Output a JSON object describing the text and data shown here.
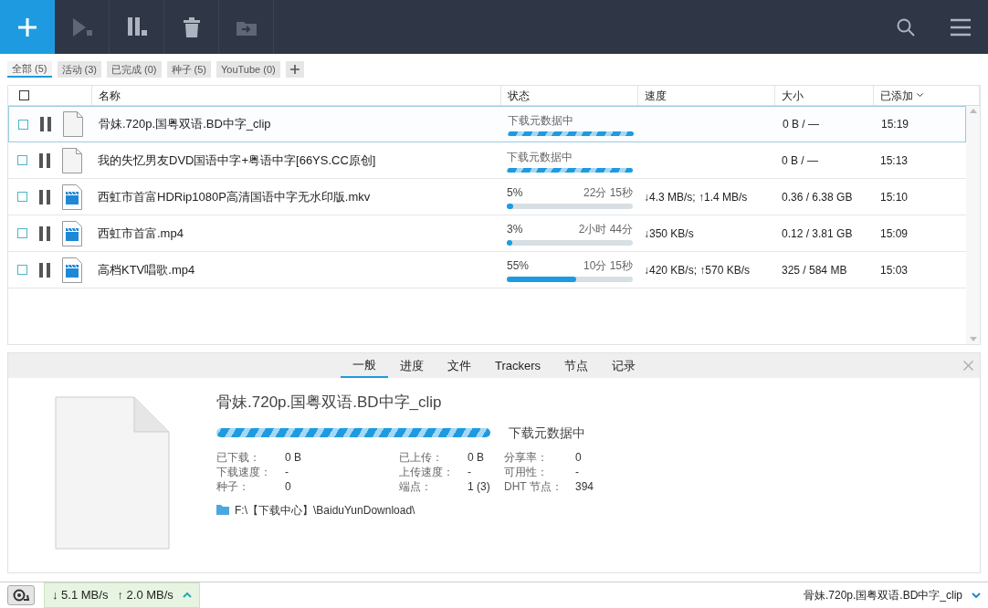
{
  "toolbar": {
    "buttons": [
      {
        "kind": "add"
      },
      {
        "kind": "resume",
        "disabled": true
      },
      {
        "kind": "pause",
        "disabled": false
      },
      {
        "kind": "delete",
        "disabled": false
      },
      {
        "kind": "move",
        "disabled": true
      }
    ]
  },
  "filters": [
    {
      "label": "全部 (5)",
      "selected": true
    },
    {
      "label": "活动 (3)",
      "selected": false
    },
    {
      "label": "已完成 (0)",
      "selected": false
    },
    {
      "label": "种子 (5)",
      "selected": false
    },
    {
      "label": "YouTube (0)",
      "selected": false
    }
  ],
  "table": {
    "all_checked": false,
    "columns": [
      "名称",
      "状态",
      "速度",
      "大小",
      "已添加"
    ],
    "rows": [
      {
        "name": "骨妹.720p.国粤双语.BD中字_clip",
        "kind": "blank",
        "selected": true,
        "checked": false,
        "status": {
          "kind": "metadata",
          "text": "下载元数据中"
        },
        "speed": "",
        "size": "0 B / —",
        "added": "15:19"
      },
      {
        "name": "我的失忆男友DVD国语中字+粤语中字[66YS.CC原创]",
        "kind": "blank",
        "selected": false,
        "checked": false,
        "status": {
          "kind": "metadata",
          "text": "下载元数据中"
        },
        "speed": "",
        "size": "0 B / —",
        "added": "15:13"
      },
      {
        "name": "西虹市首富HDRip1080P高清国语中字无水印版.mkv",
        "kind": "video",
        "selected": false,
        "checked": false,
        "status": {
          "kind": "progress",
          "percent": "5%",
          "eta": "22分 15秒",
          "level": 0.05
        },
        "speed": "↓4.3 MB/s; ↑1.4 MB/s",
        "size": "0.36 / 6.38 GB",
        "added": "15:10"
      },
      {
        "name": "西虹市首富.mp4",
        "kind": "video",
        "selected": false,
        "checked": false,
        "status": {
          "kind": "progress",
          "percent": "3%",
          "eta": "2小时 44分",
          "level": 0.03
        },
        "speed": "↓350 KB/s",
        "size": "0.12 / 3.81 GB",
        "added": "15:09"
      },
      {
        "name": "高档KTV唱歌.mp4",
        "kind": "video",
        "selected": false,
        "checked": false,
        "status": {
          "kind": "progress",
          "percent": "55%",
          "eta": "10分 15秒",
          "level": 0.55
        },
        "speed": "↓420 KB/s; ↑570 KB/s",
        "size": "325 / 584 MB",
        "added": "15:03"
      }
    ]
  },
  "details": {
    "tabs": [
      {
        "label": "一般",
        "selected": true
      },
      {
        "label": "进度",
        "selected": false
      },
      {
        "label": "文件",
        "selected": false
      },
      {
        "label": "Trackers",
        "selected": false
      },
      {
        "label": "节点",
        "selected": false
      },
      {
        "label": "记录",
        "selected": false
      }
    ],
    "title": "骨妹.720p.国粤双语.BD中字_clip",
    "status": "下载元数据中",
    "indeterminate": true,
    "stats": [
      [
        {
          "label": "已下载：",
          "value": "0 B"
        },
        {
          "label": "已上传：",
          "value": "0 B"
        },
        {
          "label": "分享率：",
          "value": "0"
        }
      ],
      [
        {
          "label": "下载速度：",
          "value": "-"
        },
        {
          "label": "上传速度：",
          "value": "-"
        },
        {
          "label": "可用性：",
          "value": "-"
        }
      ],
      [
        {
          "label": "种子：",
          "value": "0"
        },
        {
          "label": "端点：",
          "value": "1 (3)"
        },
        {
          "label": "DHT 节点：",
          "value": "394"
        }
      ]
    ],
    "path": "F:\\【下载中心】\\BaiduYunDownload\\"
  },
  "status_bar": {
    "download": "↓ 5.1 MB/s",
    "upload": "↑ 2.0 MB/s",
    "current": "骨妹.720p.国粤双语.BD中字_clip"
  }
}
